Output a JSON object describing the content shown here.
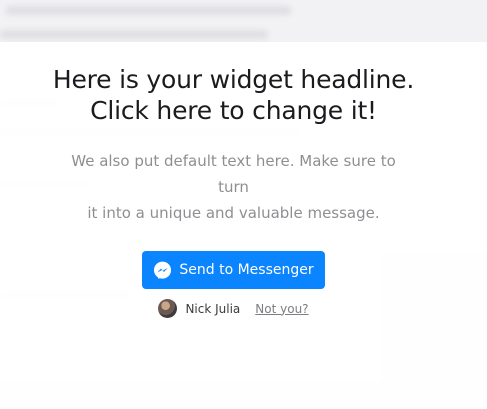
{
  "widget": {
    "headline_line1": "Here is your widget headline.",
    "headline_line2": "Click here to change it!",
    "subtext_line1": "We also put default text here. Make sure to turn",
    "subtext_line2": "it into a unique and valuable message.",
    "button_label": "Send to Messenger",
    "button_color": "#0a84ff",
    "button_icon": "messenger-icon",
    "user_name": "Nick Julia",
    "not_you_label": "Not you?"
  }
}
